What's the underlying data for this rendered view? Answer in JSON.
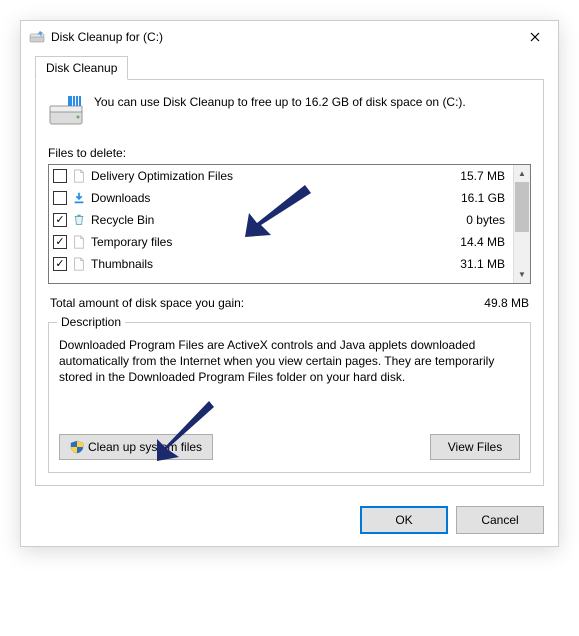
{
  "window": {
    "title": "Disk Cleanup for  (C:)"
  },
  "tabs": {
    "cleanup": "Disk Cleanup"
  },
  "intro": {
    "text": "You can use Disk Cleanup to free up to 16.2 GB of disk space on (C:)."
  },
  "labels": {
    "files_to_delete": "Files to delete:",
    "total_gain": "Total amount of disk space you gain:",
    "description": "Description"
  },
  "files": [
    {
      "name": "Delivery Optimization Files",
      "size": "15.7 MB",
      "checked": false,
      "icon": "file"
    },
    {
      "name": "Downloads",
      "size": "16.1 GB",
      "checked": false,
      "icon": "download"
    },
    {
      "name": "Recycle Bin",
      "size": "0 bytes",
      "checked": true,
      "icon": "recycle"
    },
    {
      "name": "Temporary files",
      "size": "14.4 MB",
      "checked": true,
      "icon": "file"
    },
    {
      "name": "Thumbnails",
      "size": "31.1 MB",
      "checked": true,
      "icon": "file"
    }
  ],
  "totals": {
    "gain": "49.8 MB"
  },
  "description": {
    "text": "Downloaded Program Files are ActiveX controls and Java applets downloaded automatically from the Internet when you view certain pages. They are temporarily stored in the Downloaded Program Files folder on your hard disk."
  },
  "buttons": {
    "clean_system": "Clean up system files",
    "view_files": "View Files",
    "ok": "OK",
    "cancel": "Cancel"
  }
}
